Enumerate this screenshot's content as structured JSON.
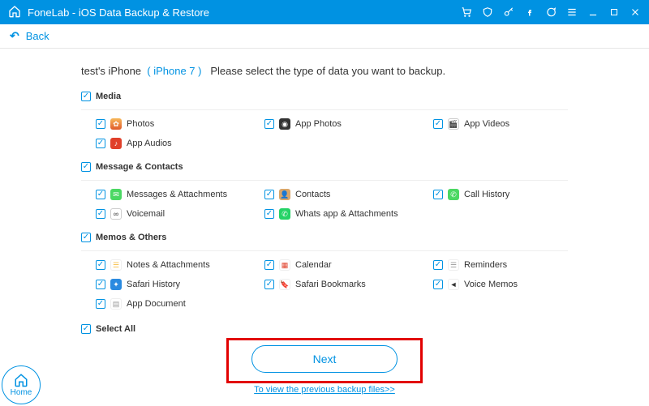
{
  "titlebar": {
    "app_name": "FoneLab - iOS Data Backup & Restore"
  },
  "backbar": {
    "label": "Back"
  },
  "heading": {
    "device_name": "test's iPhone",
    "device_model": "( iPhone 7 )",
    "instruction": "Please select the type of data you want to backup."
  },
  "sections": {
    "media": {
      "title": "Media",
      "items": [
        "Photos",
        "App Photos",
        "App Videos",
        "App Audios"
      ]
    },
    "contacts": {
      "title": "Message & Contacts",
      "items": [
        "Messages & Attachments",
        "Contacts",
        "Call History",
        "Voicemail",
        "Whats app & Attachments"
      ]
    },
    "memos": {
      "title": "Memos & Others",
      "items": [
        "Notes & Attachments",
        "Calendar",
        "Reminders",
        "Safari History",
        "Safari Bookmarks",
        "Voice Memos",
        "App Document"
      ]
    }
  },
  "select_all": "Select All",
  "footer": {
    "next": "Next",
    "prev_link": "To view the previous backup files>>"
  },
  "home_corner": "Home"
}
